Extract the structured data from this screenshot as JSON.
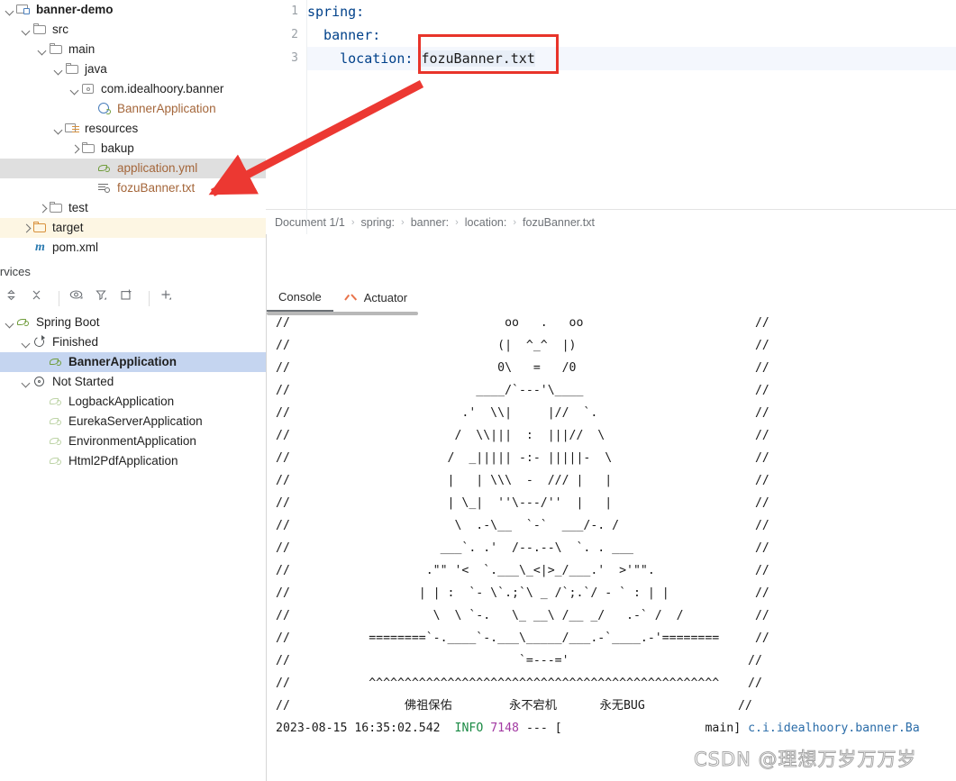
{
  "project_tree": {
    "items": [
      {
        "label": "banner-demo",
        "indent": 0,
        "chev": "down",
        "icon": "module-icon",
        "style": "bold",
        "state": "normal"
      },
      {
        "label": "src",
        "indent": 1,
        "chev": "down",
        "icon": "folder-icon",
        "style": "normal",
        "state": "normal"
      },
      {
        "label": "main",
        "indent": 2,
        "chev": "down",
        "icon": "folder-icon",
        "style": "normal",
        "state": "normal"
      },
      {
        "label": "java",
        "indent": 3,
        "chev": "down",
        "icon": "folder-icon",
        "style": "normal",
        "state": "normal"
      },
      {
        "label": "com.idealhoory.banner",
        "indent": 4,
        "chev": "down",
        "icon": "package-icon",
        "style": "normal",
        "state": "normal"
      },
      {
        "label": "BannerApplication",
        "indent": 5,
        "chev": "none",
        "icon": "java-class-icon",
        "style": "orange",
        "state": "normal"
      },
      {
        "label": "resources",
        "indent": 3,
        "chev": "down",
        "icon": "resources-root-icon",
        "style": "normal",
        "state": "normal"
      },
      {
        "label": "bakup",
        "indent": 4,
        "chev": "right",
        "icon": "folder-icon",
        "style": "normal",
        "state": "normal"
      },
      {
        "label": "application.yml",
        "indent": 5,
        "chev": "none",
        "icon": "yaml-spring-icon",
        "style": "file",
        "state": "selected"
      },
      {
        "label": "fozuBanner.txt",
        "indent": 5,
        "chev": "none",
        "icon": "text-file-icon",
        "style": "file",
        "state": "normal"
      },
      {
        "label": "test",
        "indent": 2,
        "chev": "right",
        "icon": "folder-icon",
        "style": "normal",
        "state": "normal"
      },
      {
        "label": "target",
        "indent": 1,
        "chev": "right",
        "icon": "folder-excluded-icon",
        "style": "normal",
        "state": "target"
      },
      {
        "label": "pom.xml",
        "indent": 1,
        "chev": "none",
        "icon": "maven-icon",
        "style": "normal",
        "state": "normal"
      }
    ]
  },
  "editor": {
    "line_numbers": [
      "1",
      "2",
      "3"
    ],
    "lines": [
      {
        "text": "spring:",
        "value": "",
        "indent": 0
      },
      {
        "text": "  banner:",
        "value": "",
        "indent": 0
      },
      {
        "text": "    location: ",
        "value": "fozuBanner.txt",
        "indent": 0
      }
    ],
    "highlight_color": "#e8342a",
    "breadcrumb": [
      "Document 1/1",
      "spring:",
      "banner:",
      "location:",
      "fozuBanner.txt"
    ]
  },
  "services": {
    "title": "Services",
    "toolbar_icons": [
      "expand-collapse-icon",
      "collapse-all-icon",
      "show-hide-icon",
      "filter-icon",
      "open-in-new-tab-icon",
      "add-icon"
    ],
    "tree": [
      {
        "label": "Spring Boot",
        "indent": 0,
        "chev": "down",
        "icon": "spring-icon",
        "state": "normal"
      },
      {
        "label": "Finished",
        "indent": 1,
        "chev": "down",
        "icon": "rerun-icon",
        "state": "normal"
      },
      {
        "label": "BannerApplication",
        "indent": 2,
        "chev": "none",
        "icon": "spring-run-icon",
        "state": "selected"
      },
      {
        "label": "Not Started",
        "indent": 1,
        "chev": "down",
        "icon": "gear-icon",
        "state": "normal"
      },
      {
        "label": "LogbackApplication",
        "indent": 2,
        "chev": "none",
        "icon": "spring-run-faded-icon",
        "state": "normal"
      },
      {
        "label": "EurekaServerApplication",
        "indent": 2,
        "chev": "none",
        "icon": "spring-run-faded-icon",
        "state": "normal"
      },
      {
        "label": "EnvironmentApplication",
        "indent": 2,
        "chev": "none",
        "icon": "spring-run-faded-icon",
        "state": "normal"
      },
      {
        "label": "Html2PdfApplication",
        "indent": 2,
        "chev": "none",
        "icon": "spring-run-faded-icon",
        "state": "normal"
      }
    ]
  },
  "run_panel": {
    "tabs": [
      {
        "label": "Console",
        "icon": "none",
        "active": true
      },
      {
        "label": "Actuator",
        "icon": "actuator-icon",
        "active": false
      }
    ],
    "console_banner": [
      "//                              oo   .   oo                        //",
      "//                             (|  ^_^  |)                         //",
      "//                             0\\   =   /0                         //",
      "//                          ____/`---'\\____                        //",
      "//                        .'  \\\\|     |//  `.                      //",
      "//                       /  \\\\|||  :  |||//  \\                     //",
      "//                      /  _||||| -:- |||||-  \\                    //",
      "//                      |   | \\\\\\  -  /// |   |                    //",
      "//                      | \\_|  ''\\---/''  |   |                    //",
      "//                       \\  .-\\__  `-`  ___/-. /                   //",
      "//                     ___`. .'  /--.--\\  `. . ___                 //",
      "//                   .\"\" '<  `.___\\_<|>_/___.'  >'\"\".              //",
      "//                  | | :  `- \\`.;`\\ _ /`;.`/ - ` : | |            //",
      "//                    \\  \\ `-.   \\_ __\\ /__ _/   .-` /  /          //",
      "//           ========`-.____`-.___\\_____/___.-`____.-'========     //",
      "//                                `=---='                         //",
      "//           ^^^^^^^^^^^^^^^^^^^^^^^^^^^^^^^^^^^^^^^^^^^^^^^^^    //",
      "//                佛祖保佑        永不宕机      永无BUG             //"
    ],
    "log_lines": [
      {
        "date": "2023-08-15 16:35:02.542",
        "level": "INFO",
        "pid": "7148",
        "dashes": "--- [",
        "thread": "main]",
        "logger": "c.i.idealhoory.banner.Ba"
      }
    ]
  },
  "watermark": {
    "text": "CSDN @理想万岁万万岁"
  },
  "colors": {
    "accent_red": "#e8342a",
    "selection_blue": "#c5d5f0",
    "selection_grey": "#dfdfdf",
    "target_yellow": "#fdf6e3",
    "file_orange": "#a4663a",
    "log_info_green": "#1a8a44",
    "log_pid_magenta": "#a33ba3"
  }
}
